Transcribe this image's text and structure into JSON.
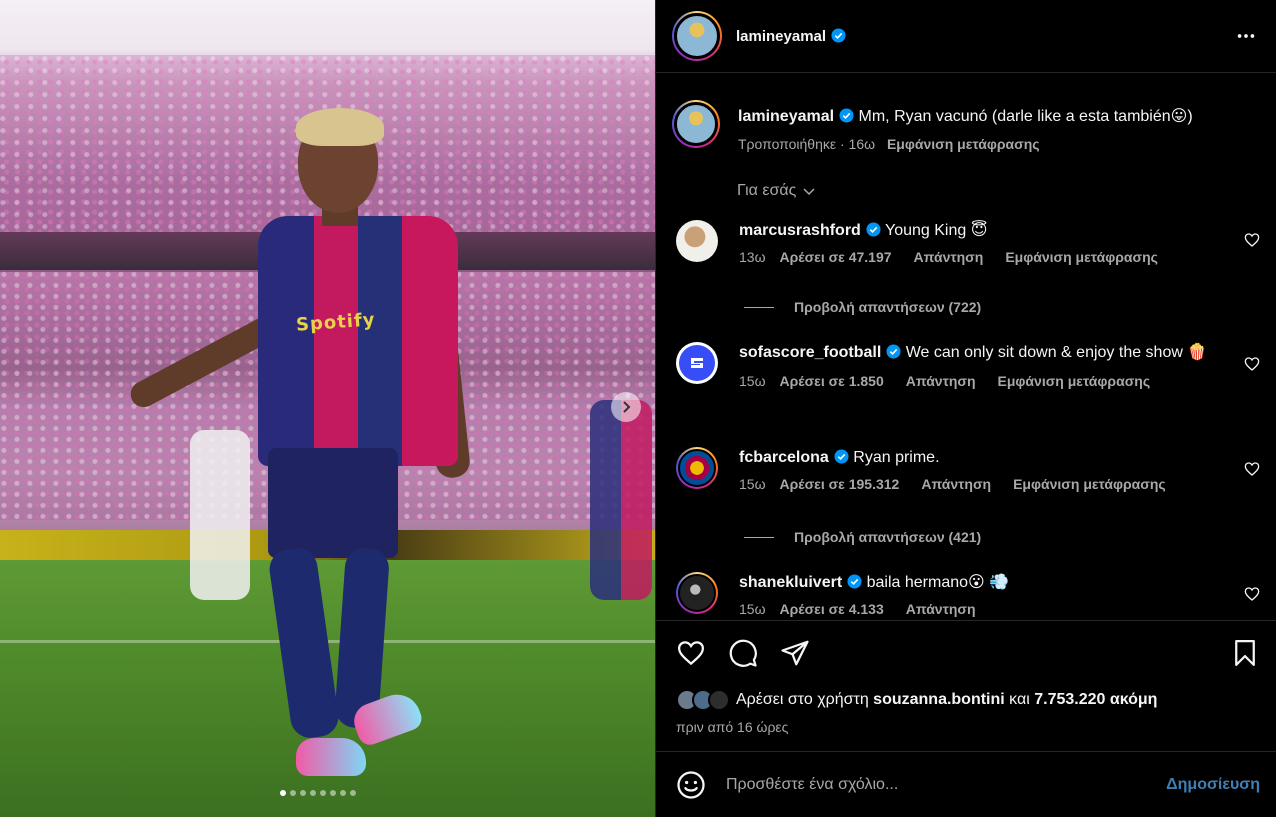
{
  "media": {
    "shirt_sponsor": "Spotify",
    "carousel": {
      "slide_count": 8,
      "active_index": 0
    }
  },
  "header": {
    "username": "lamineyamal"
  },
  "caption": {
    "username": "lamineyamal",
    "text": "Mm, Ryan vacunó (darle like a esta también😛)",
    "edited": "Τροποποιήθηκε · 16ω",
    "translate": "Εμφάνιση μετάφρασης"
  },
  "filter": {
    "label": "Για εσάς"
  },
  "comments": [
    {
      "username": "marcusrashford",
      "text": "Young King 😇",
      "time": "13ω",
      "likes": "Αρέσει σε 47.197",
      "reply": "Απάντηση",
      "translate": "Εμφάνιση μετάφρασης",
      "view_replies": "Προβολή απαντήσεων (722)"
    },
    {
      "username": "sofascore_football",
      "text": "We can only sit down & enjoy the show 🍿",
      "time": "15ω",
      "likes": "Αρέσει σε 1.850",
      "reply": "Απάντηση",
      "translate": "Εμφάνιση μετάφρασης"
    },
    {
      "username": "fcbarcelona",
      "text": "Ryan prime.",
      "time": "15ω",
      "likes": "Αρέσει σε 195.312",
      "reply": "Απάντηση",
      "translate": "Εμφάνιση μετάφρασης",
      "view_replies": "Προβολή απαντήσεων (421)"
    },
    {
      "username": "shanekluivert",
      "text": "baila hermano😮 💨",
      "time": "15ω",
      "likes": "Αρέσει σε 4.133",
      "reply": "Απάντηση"
    }
  ],
  "actions": {
    "likes_prefix": "Αρέσει στο χρήστη",
    "liked_by": "souzanna.bontini",
    "likes_conj": "και",
    "likes_count": "7.753.220 ακόμη",
    "posted_ago": "πριν από 16 ώρες"
  },
  "add_comment": {
    "placeholder": "Προσθέστε ένα σχόλιο...",
    "post_label": "Δημοσίευση"
  },
  "colors": {
    "verified": "#0095f6",
    "link_disabled": "#3f7fb3",
    "secondary_text": "#a8a8a8"
  },
  "icons": [
    "heart-icon",
    "comment-icon",
    "share-icon",
    "bookmark-icon",
    "more-icon",
    "emoji-icon",
    "chevron-down-icon",
    "chevron-right-icon",
    "verified-icon"
  ]
}
